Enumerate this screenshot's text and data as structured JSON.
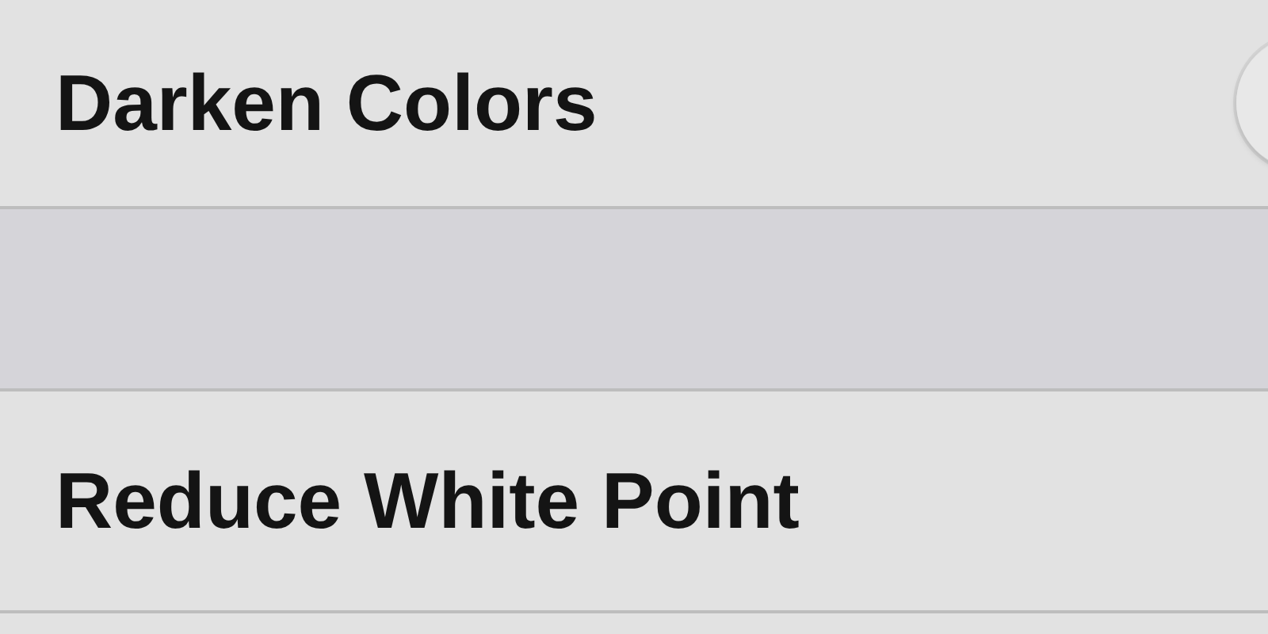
{
  "rows": [
    {
      "kind": "toggle",
      "label": "Darken Colors",
      "on": false
    },
    {
      "kind": "spacer"
    },
    {
      "kind": "plain",
      "label": "Reduce White Point"
    },
    {
      "kind": "spacer"
    }
  ]
}
